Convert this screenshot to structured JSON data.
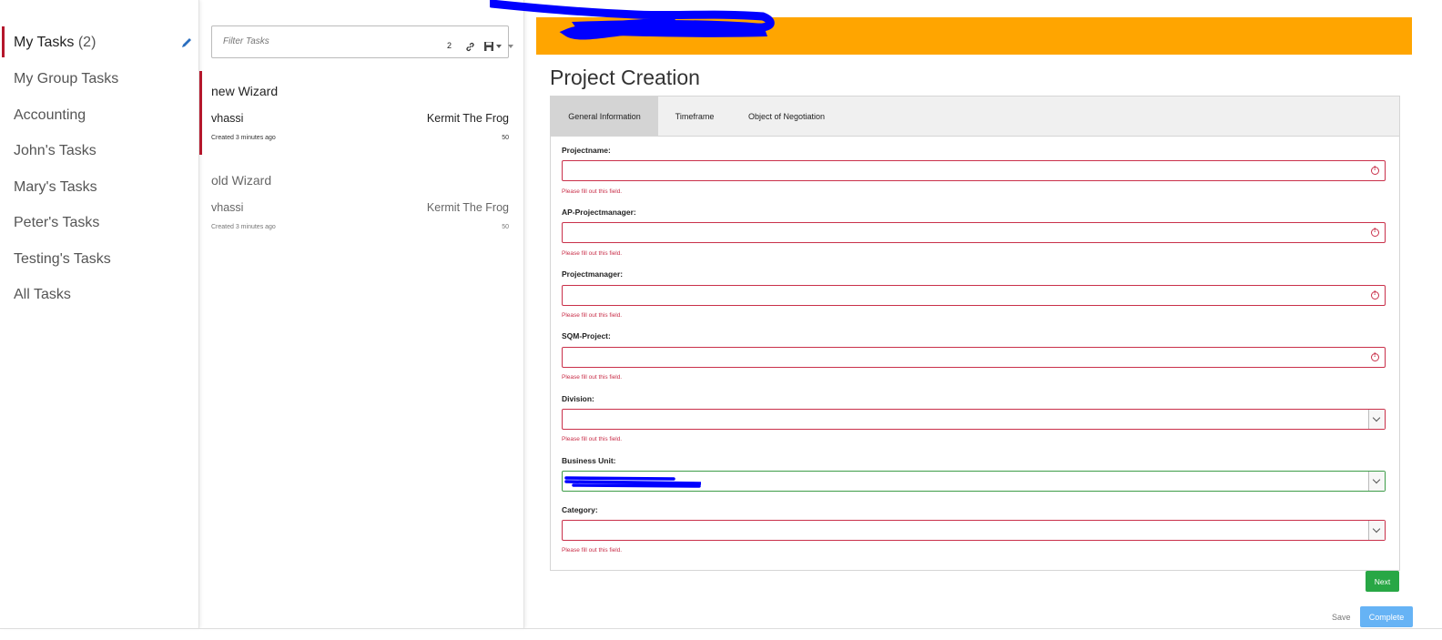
{
  "filters": {
    "items": [
      {
        "label": "My Tasks",
        "count": "(2)"
      },
      {
        "label": "My Group Tasks"
      },
      {
        "label": "Accounting"
      },
      {
        "label": "John's Tasks"
      },
      {
        "label": "Mary's Tasks"
      },
      {
        "label": "Peter's Tasks"
      },
      {
        "label": "Testing's Tasks"
      },
      {
        "label": "All Tasks"
      }
    ],
    "edit_icon": "pencil-icon"
  },
  "tasklist": {
    "filter_placeholder": "Filter Tasks",
    "result_count": "2",
    "link_icon": "link-icon",
    "save_icon": "floppy-icon",
    "tasks": [
      {
        "name": "new Wizard",
        "user": "vhassi",
        "assignee": "Kermit The Frog",
        "created": "Created 3 minutes ago",
        "priority": "50"
      },
      {
        "name": "old Wizard",
        "user": "vhassi",
        "assignee": "Kermit The Frog",
        "created": "Created 3 minutes ago",
        "priority": "50"
      }
    ]
  },
  "form": {
    "title": "Project Creation",
    "banner_color": "#ffa500",
    "tabs": [
      {
        "label": "General Information"
      },
      {
        "label": "Timeframe"
      },
      {
        "label": "Object of Negotiation"
      }
    ],
    "fields": [
      {
        "label": "Projectname:",
        "error": "Please fill out this field."
      },
      {
        "label": "AP-Projectmanager:",
        "error": "Please fill out this field."
      },
      {
        "label": "Projectmanager:",
        "error": "Please fill out this field."
      },
      {
        "label": "SQM-Project:",
        "error": "Please fill out this field."
      },
      {
        "label": "Division:",
        "error": "Please fill out this field."
      },
      {
        "label": "Business Unit:"
      },
      {
        "label": "Category:",
        "error": "Please fill out this field."
      }
    ],
    "next_label": "Next",
    "save_label": "Save",
    "complete_label": "Complete",
    "colors": {
      "error": "#c9304a",
      "valid": "#3d9c48",
      "next": "#28a745",
      "complete": "#66b3f5",
      "active_marker": "#b5172c"
    }
  }
}
